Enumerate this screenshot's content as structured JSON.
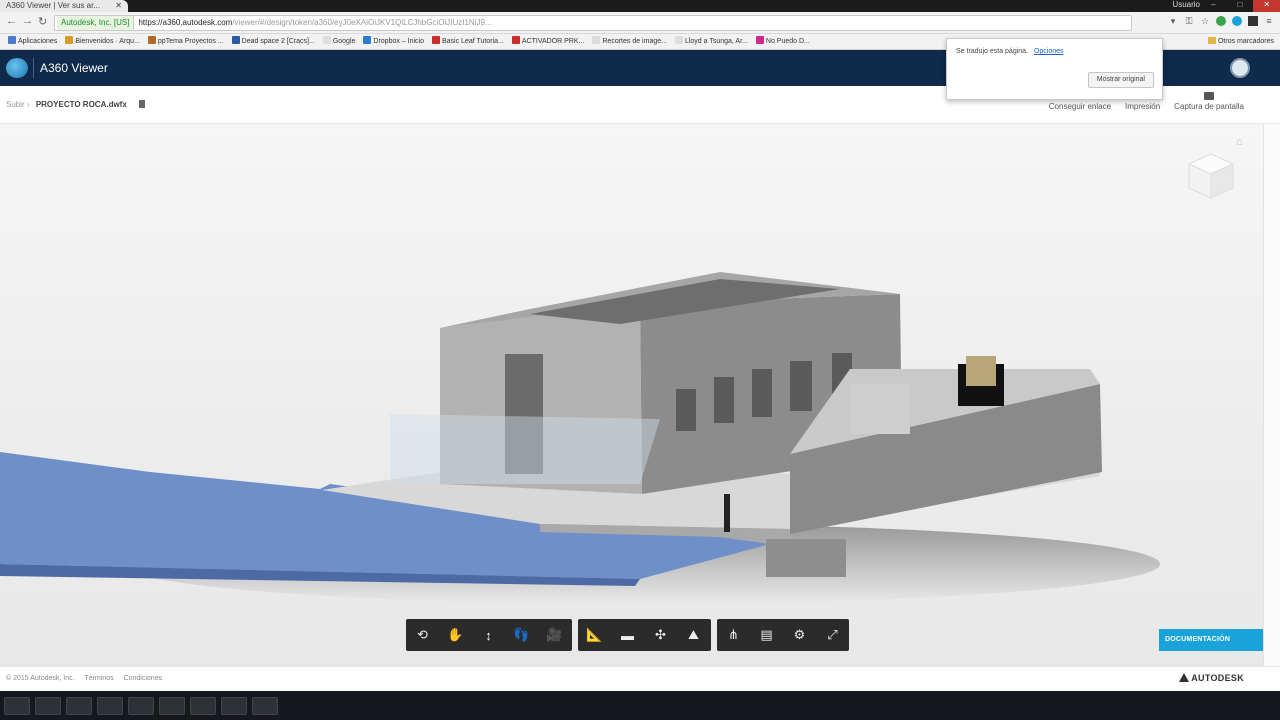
{
  "browser": {
    "tab_title": "A360 Viewer | Ver sus ar...",
    "user_name": "Usuario",
    "window_buttons": {
      "minimize": "–",
      "maximize": "□",
      "close": "✕"
    },
    "security_badge": "Autodesk, Inc. [US]",
    "url_host": "https://a360.autodesk.com",
    "url_rest": "/viewer/#/design/token/a360/eyJ0eXAiOiJKV1QiLCJhbGciOiJIUzI1NiJ9...",
    "bookmarks": [
      {
        "label": "Aplicaciones",
        "color": "#4a7ac9"
      },
      {
        "label": "Bienvenidos · Arqu...",
        "color": "#d99b2b"
      },
      {
        "label": "ppTema Proyectos ...",
        "color": "#b0692b"
      },
      {
        "label": "Dead space 2 [Cracs]...",
        "color": "#2a5d9e"
      },
      {
        "label": "Google",
        "color": "#dddddd"
      },
      {
        "label": "Dropbox – Inicio",
        "color": "#2d7cd1"
      },
      {
        "label": "Basic Leaf Tutoria...",
        "color": "#cc2b2b"
      },
      {
        "label": "ACTIVADOR PRK...",
        "color": "#cc2b2b"
      },
      {
        "label": "Recortes de image...",
        "color": "#dddddd"
      },
      {
        "label": "Lloyd a Tsunga, Ar...",
        "color": "#dddddd"
      },
      {
        "label": "No Puedo D...",
        "color": "#cc2b88"
      }
    ],
    "bookmarks_other": "Otros marcadores"
  },
  "app": {
    "title": "A360 Viewer",
    "breadcrumb_root": "Subir",
    "file_name": "PROYECTO ROCA.dwfx",
    "actions": [
      {
        "label": "Conseguir enlace"
      },
      {
        "label": "Impresión"
      },
      {
        "label": "Captura de pantalla"
      }
    ]
  },
  "translate_popup": {
    "message": "Se tradujo esta página.",
    "options_link": "Opciones",
    "show_original": "Mostrar original"
  },
  "toolbar": {
    "groups": [
      [
        {
          "icon": "orbit-icon",
          "glyph": "⟲"
        },
        {
          "icon": "pan-icon",
          "glyph": "✋"
        },
        {
          "icon": "zoom-icon",
          "glyph": "↕"
        },
        {
          "icon": "first-person-icon",
          "glyph": "👣"
        },
        {
          "icon": "camera-icon",
          "glyph": "🎥"
        }
      ],
      [
        {
          "icon": "measure-icon",
          "glyph": "📐"
        },
        {
          "icon": "section-icon",
          "glyph": "▬"
        },
        {
          "icon": "explode-icon",
          "glyph": "✣"
        },
        {
          "icon": "level-icon",
          "glyph": "⛰"
        }
      ],
      [
        {
          "icon": "model-tree-icon",
          "glyph": "⋔"
        },
        {
          "icon": "properties-icon",
          "glyph": "▤"
        },
        {
          "icon": "settings-icon",
          "glyph": "⚙"
        },
        {
          "icon": "fullscreen-icon",
          "glyph": "⤢"
        }
      ]
    ]
  },
  "documentation_button": "DOCUMENTACIÓN",
  "footer": {
    "copyright": "© 2015 Autodesk, Inc.",
    "links": [
      "Términos",
      "Condiciones"
    ],
    "brand": "AUTODESK"
  }
}
